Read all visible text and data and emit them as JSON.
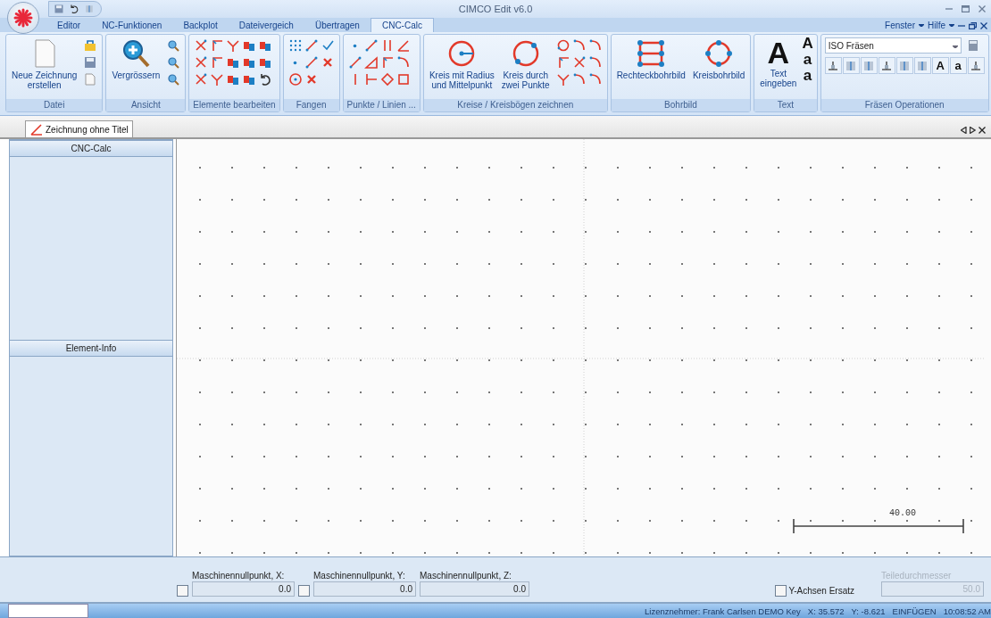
{
  "window": {
    "title": "CIMCO Edit v6.0"
  },
  "menu_tabs": [
    {
      "label": "Editor",
      "selected": false
    },
    {
      "label": "NC-Funktionen",
      "selected": false
    },
    {
      "label": "Backplot",
      "selected": false
    },
    {
      "label": "Dateivergeich",
      "selected": false
    },
    {
      "label": "Übertragen",
      "selected": false
    },
    {
      "label": "CNC-Calc",
      "selected": true
    }
  ],
  "menu_right": [
    "Fenster",
    "Hilfe"
  ],
  "ribbon_groups": [
    {
      "label": "Datei",
      "large_buttons": [
        {
          "kind": "page",
          "lines": [
            "Neue Zeichnung",
            "erstellen"
          ]
        }
      ]
    },
    {
      "label": "Ansicht",
      "large_buttons": [
        {
          "kind": "zoom",
          "lines": [
            "Vergrössern"
          ]
        }
      ]
    },
    {
      "label": "Elemente bearbeiten"
    },
    {
      "label": "Fangen"
    },
    {
      "label": "Punkte / Linien ..."
    },
    {
      "label": "Kreise / Kreisbögen zeichnen",
      "large_buttons": [
        {
          "kind": "circle-center",
          "lines": [
            "Kreis mit Radius",
            "und Mittelpunkt"
          ]
        },
        {
          "kind": "circle-two",
          "lines": [
            "Kreis durch",
            "zwei Punkte"
          ]
        }
      ]
    },
    {
      "label": "Bohrbild",
      "large_buttons": [
        {
          "kind": "rect-holes",
          "lines": [
            "Rechteckbohrbild"
          ]
        },
        {
          "kind": "circle-holes",
          "lines": [
            "Kreisbohrbild"
          ]
        }
      ]
    },
    {
      "label": "Text",
      "large_buttons": [
        {
          "kind": "glyph",
          "glyph": "A",
          "lines": [
            "Text",
            "eingeben"
          ]
        }
      ],
      "glyphs": [
        "A",
        "a",
        "a"
      ]
    },
    {
      "label": "Fräsen Operationen",
      "dropdown": "ISO Fräsen",
      "glyphs": [
        "A",
        "a"
      ]
    }
  ],
  "document_tab": {
    "label": "Zeichnung ohne Titel",
    "selected": true
  },
  "side_panels": [
    {
      "title": "CNC-Calc"
    },
    {
      "title": "Element-Info"
    }
  ],
  "canvas": {
    "scale_label": "40.00"
  },
  "fields": [
    {
      "label": "Maschinennullpunkt, X:",
      "value": "0.0",
      "checked": false
    },
    {
      "label": "Maschinennullpunkt, Y:",
      "value": "0.0",
      "checked": false
    },
    {
      "label": "Maschinennullpunkt, Z:",
      "value": "0.0"
    }
  ],
  "y_axis_option": {
    "label": "Y-Achsen Ersatz",
    "checked": false
  },
  "diameter_field": {
    "label": "Teiledurchmesser",
    "value": "50.0",
    "disabled": true
  },
  "status_bar": [
    "Lizenznehmer: Frank Carlsen DEMO Key",
    "X:  35.572",
    "Y: -8.621",
    "EINFÜGEN",
    "10:08:52 AM"
  ]
}
